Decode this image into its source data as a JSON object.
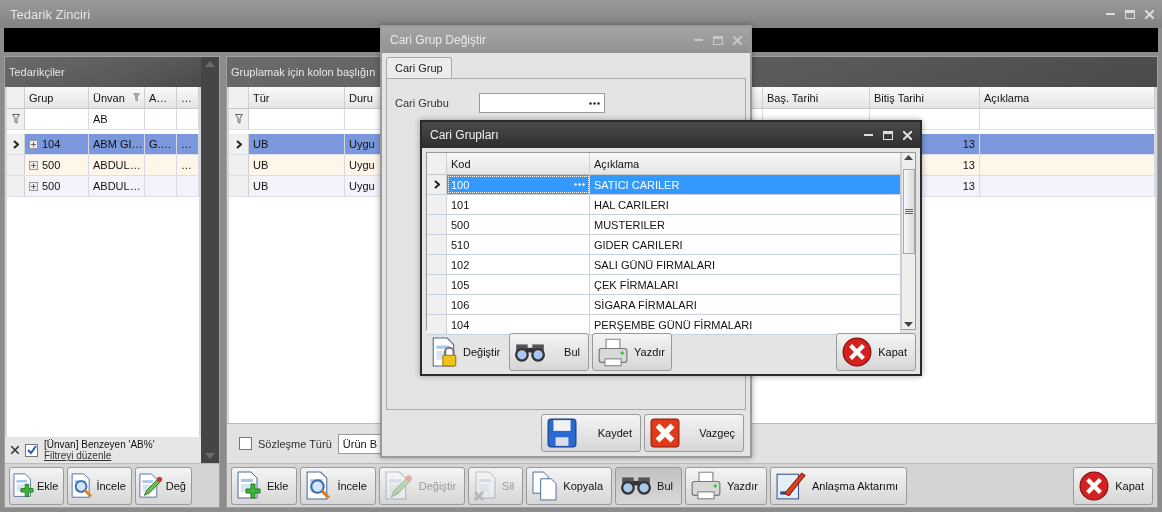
{
  "window": {
    "title": "Tedarik Zinciri"
  },
  "suppliers": {
    "title": "Tedarikçiler",
    "columns": [
      {
        "label": "Grup",
        "filtered": false
      },
      {
        "label": "Ünvan",
        "filtered": true,
        "filter_value": "AB"
      },
      {
        "label": "A…",
        "filtered": false
      },
      {
        "label": "…",
        "filtered": false
      }
    ],
    "rows": [
      {
        "selected": true,
        "expanded": false,
        "grup": "104",
        "unvan": "ABM GI…",
        "column_3": "G.…",
        "column_4": "…"
      },
      {
        "selected": false,
        "expanded": false,
        "grup": "500",
        "unvan": "ABDUL…",
        "column_4": "…"
      },
      {
        "selected": false,
        "expanded": false,
        "grup": "500",
        "unvan": "ABDUL…"
      }
    ],
    "filter_bar": {
      "enabled": true,
      "text": "[Ünvan] Benzeyen 'AB%'",
      "edit_link": "Filtreyi düzenle"
    },
    "toolbar": [
      {
        "label": "Ekle",
        "kind": "add",
        "disabled": false,
        "pressed": false
      },
      {
        "label": "İncele",
        "kind": "view",
        "disabled": false,
        "pressed": false
      },
      {
        "label": "Değ",
        "kind": "edit",
        "disabled": false,
        "pressed": false
      }
    ]
  },
  "contracts": {
    "group_hint": "Gruplamak için kolon başlığın",
    "columns": [
      "Tür",
      "Duru",
      "Baş. Tarihi",
      "Bitiş Tarihi",
      "Açıklama"
    ],
    "rows": [
      {
        "selected": true,
        "tur": "UB",
        "durum": "Uygu",
        "bitis": "13"
      },
      {
        "selected": false,
        "tur": "UB",
        "durum": "Uygu",
        "bitis": "13"
      },
      {
        "selected": false,
        "tur": "UB",
        "durum": "Uygu",
        "bitis": "13"
      }
    ],
    "contract_type": {
      "label": "Sözleşme Türü",
      "checked": false,
      "value": "Ürün B"
    },
    "toolbar": [
      {
        "label": "Ekle",
        "kind": "add",
        "disabled": false,
        "pressed": false
      },
      {
        "label": "İncele",
        "kind": "view",
        "disabled": false,
        "pressed": false
      },
      {
        "label": "Değiştir",
        "kind": "edit",
        "disabled": true,
        "pressed": false
      },
      {
        "label": "Sil",
        "kind": "delete",
        "disabled": true,
        "pressed": false
      },
      {
        "label": "Kopyala",
        "kind": "copy",
        "disabled": false,
        "pressed": false
      },
      {
        "label": "Bul",
        "kind": "find",
        "disabled": false,
        "pressed": true
      },
      {
        "label": "Yazdır",
        "kind": "print",
        "disabled": false,
        "pressed": false
      },
      {
        "label": "Anlaşma Aktarımı",
        "kind": "transfer",
        "disabled": false,
        "pressed": false
      }
    ],
    "close_button": {
      "label": "Kapat",
      "kind": "close"
    }
  },
  "group_dialog": {
    "title": "Cari Grup Değiştir",
    "tabs": [
      {
        "label": "Cari Grup",
        "selected": true
      }
    ],
    "field": {
      "label": "Cari Grubu"
    },
    "buttons": [
      {
        "label": "Kaydet",
        "kind": "save"
      },
      {
        "label": "Vazgeç",
        "kind": "cancel"
      }
    ]
  },
  "groups_dialog": {
    "title": "Cari Grupları",
    "columns": [
      "Kod",
      "Açıklama"
    ],
    "rows": [
      {
        "selected": true,
        "kod": "100",
        "aciklama": "SATICI CARILER"
      },
      {
        "selected": false,
        "kod": "101",
        "aciklama": "HAL CARILERI"
      },
      {
        "selected": false,
        "kod": "500",
        "aciklama": "MUSTERILER"
      },
      {
        "selected": false,
        "kod": "510",
        "aciklama": "GIDER CARILERI"
      },
      {
        "selected": false,
        "kod": "102",
        "aciklama": "SALI GÜNÜ FIRMALARI"
      },
      {
        "selected": false,
        "kod": "105",
        "aciklama": "ÇEK FİRMALARI"
      },
      {
        "selected": false,
        "kod": "106",
        "aciklama": "SİGARA FİRMALARI"
      },
      {
        "selected": false,
        "kod": "104",
        "aciklama": "PERŞEMBE GÜNÜ FİRMALARI"
      }
    ],
    "buttons": [
      {
        "label": "Değiştir",
        "kind": "lock",
        "flat": true
      },
      {
        "label": "Bul",
        "kind": "find",
        "flat": false
      },
      {
        "label": "Yazdır",
        "kind": "print",
        "flat": false
      }
    ],
    "close_button": {
      "label": "Kapat",
      "kind": "close"
    }
  }
}
